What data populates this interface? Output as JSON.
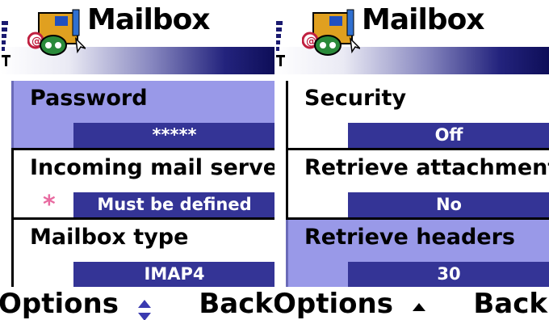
{
  "screens": [
    {
      "title": "Mailbox",
      "items": [
        {
          "label": "Password",
          "value": "*****",
          "selected": true,
          "required": false
        },
        {
          "label": "Incoming mail server",
          "value": "Must be defined",
          "selected": false,
          "required": true
        },
        {
          "label": "Mailbox type",
          "value": "IMAP4",
          "selected": false,
          "required": false
        }
      ],
      "softkeys": {
        "left": "Options",
        "middle_icon": "up-down-arrows-icon",
        "right": "Back"
      }
    },
    {
      "title": "Mailbox",
      "items": [
        {
          "label": "Security",
          "value": "Off",
          "selected": false,
          "required": false
        },
        {
          "label": "Retrieve attachment",
          "value": "No",
          "selected": false,
          "required": false
        },
        {
          "label": "Retrieve headers",
          "value": "30",
          "selected": true,
          "required": false
        }
      ],
      "softkeys": {
        "left": "Options",
        "middle_icon": "up-arrow-icon",
        "right": "Back"
      }
    }
  ],
  "required_marker": "*",
  "colors": {
    "selected_bg": "#9999e8",
    "value_bg": "#343496",
    "title_bar_dark": "#0e0e58",
    "required_star": "#e86aa0"
  }
}
